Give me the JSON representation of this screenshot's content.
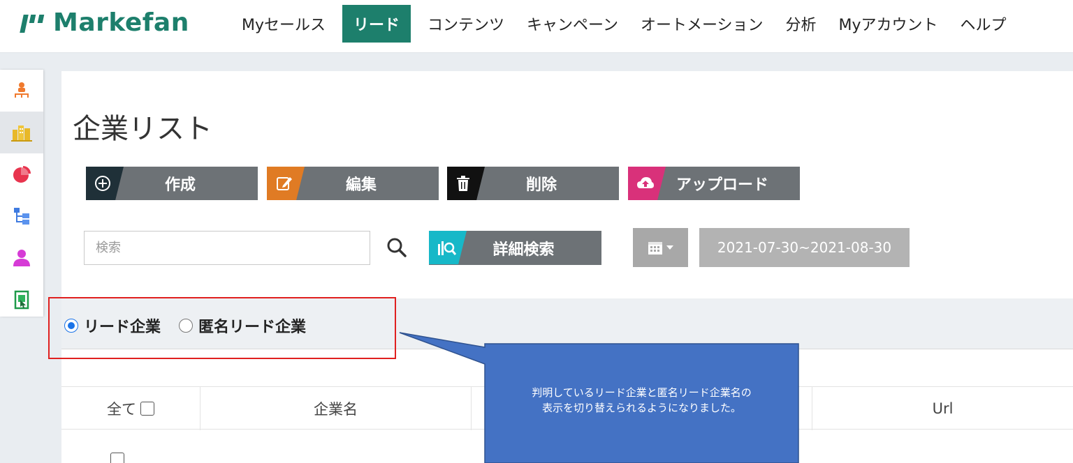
{
  "app": {
    "logo_text": "Markefan"
  },
  "nav": {
    "items": [
      {
        "label": "Myセールス",
        "active": false
      },
      {
        "label": "リード",
        "active": true
      },
      {
        "label": "コンテンツ",
        "active": false
      },
      {
        "label": "キャンペーン",
        "active": false
      },
      {
        "label": "オートメーション",
        "active": false
      },
      {
        "label": "分析",
        "active": false
      },
      {
        "label": "Myアカウント",
        "active": false
      },
      {
        "label": "ヘルプ",
        "active": false
      }
    ]
  },
  "sidebar": {
    "icons": [
      "org-chart-icon",
      "company-icon",
      "pie-chart-icon",
      "tree-icon",
      "person-icon",
      "document-icon"
    ],
    "active_index": 1
  },
  "page": {
    "title": "企業リスト"
  },
  "actions": {
    "create": "作成",
    "edit": "編集",
    "delete": "削除",
    "upload": "アップロード"
  },
  "search": {
    "placeholder": "検索",
    "advanced_label": "詳細検索",
    "date_range": "2021-07-30~2021-08-30"
  },
  "filter": {
    "options": [
      {
        "label": "リード企業",
        "selected": true
      },
      {
        "label": "匿名リード企業",
        "selected": false
      }
    ]
  },
  "table": {
    "columns": [
      "全て",
      "企業名",
      "",
      "Url"
    ]
  },
  "annotation": {
    "line1": "判明しているリード企業と匿名リード企業名の",
    "line2": "表示を切り替えられるようになりました。"
  },
  "colors": {
    "brand": "#1d7f6c",
    "create": "#1f3038",
    "edit": "#e07b24",
    "delete": "#111111",
    "upload": "#d9317a",
    "advanced": "#17b8c8",
    "button_body": "#6d7276",
    "highlight": "#e0201f",
    "callout": "#4472c4"
  }
}
